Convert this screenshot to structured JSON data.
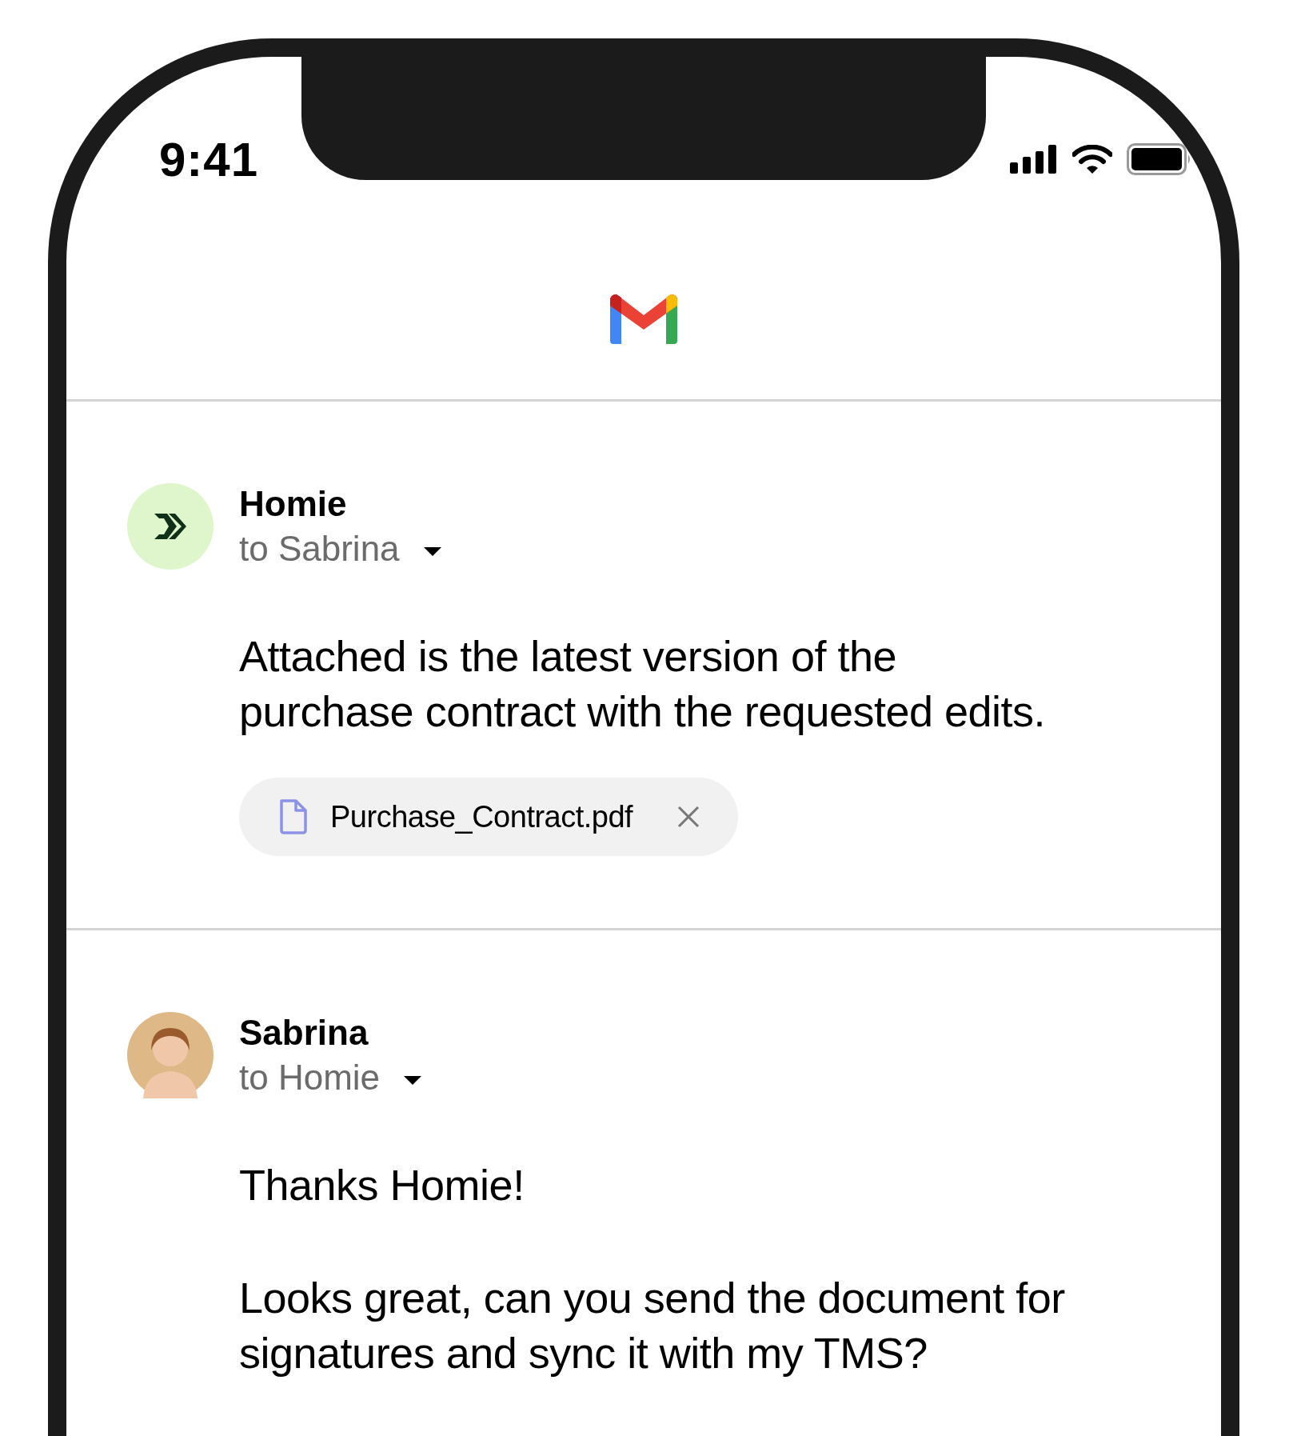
{
  "status_bar": {
    "time": "9:41"
  },
  "messages": [
    {
      "sender": "Homie",
      "recipients": "to Sabrina",
      "kind": "logo",
      "paragraphs": [
        [
          "Attached is the latest version of the",
          "purchase contract with the requested edits."
        ]
      ],
      "attachments": [
        {
          "name": "Purchase_Contract.pdf"
        }
      ]
    },
    {
      "sender": "Sabrina",
      "recipients": "to Homie",
      "kind": "person",
      "paragraphs": [
        [
          "Thanks Homie!"
        ],
        [
          "Looks great, can you send the document for",
          "signatures and sync it with my TMS?"
        ]
      ]
    }
  ]
}
